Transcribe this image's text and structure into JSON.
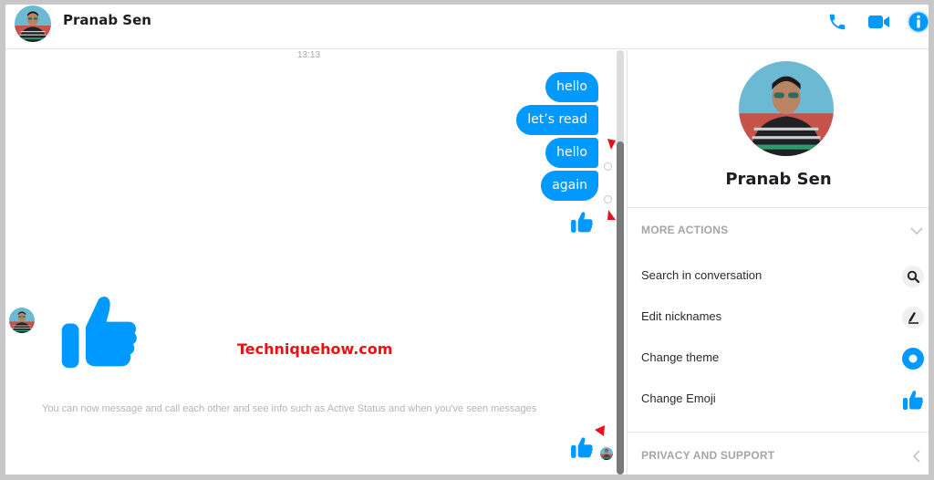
{
  "header": {
    "contact_name": "Pranab Sen",
    "icons": [
      "phone-icon",
      "video-camera-icon",
      "info-icon"
    ]
  },
  "chat": {
    "timestamp": "13:13",
    "sent_messages": [
      {
        "text": "hello"
      },
      {
        "text": "let’s read"
      },
      {
        "text": "hello"
      },
      {
        "text": "again"
      }
    ],
    "system_info": "You can now message and call each other and see info such as Active Status and when you've seen messages",
    "watermark": "Techniquehow.com"
  },
  "panel": {
    "profile_name": "Pranab Sen",
    "more_actions": {
      "title": "MORE ACTIONS",
      "items": [
        {
          "label": "Search in conversation",
          "icon": "search-icon"
        },
        {
          "label": "Edit nicknames",
          "icon": "pencil-icon"
        },
        {
          "label": "Change theme",
          "icon": "theme-circle-icon"
        },
        {
          "label": "Change Emoji",
          "icon": "thumbs-up-icon"
        }
      ]
    },
    "privacy_support": {
      "title": "PRIVACY AND SUPPORT"
    }
  },
  "colors": {
    "accent": "#0099ff",
    "marker_red": "#e8101a",
    "muted_text": "#a5a5a5"
  }
}
